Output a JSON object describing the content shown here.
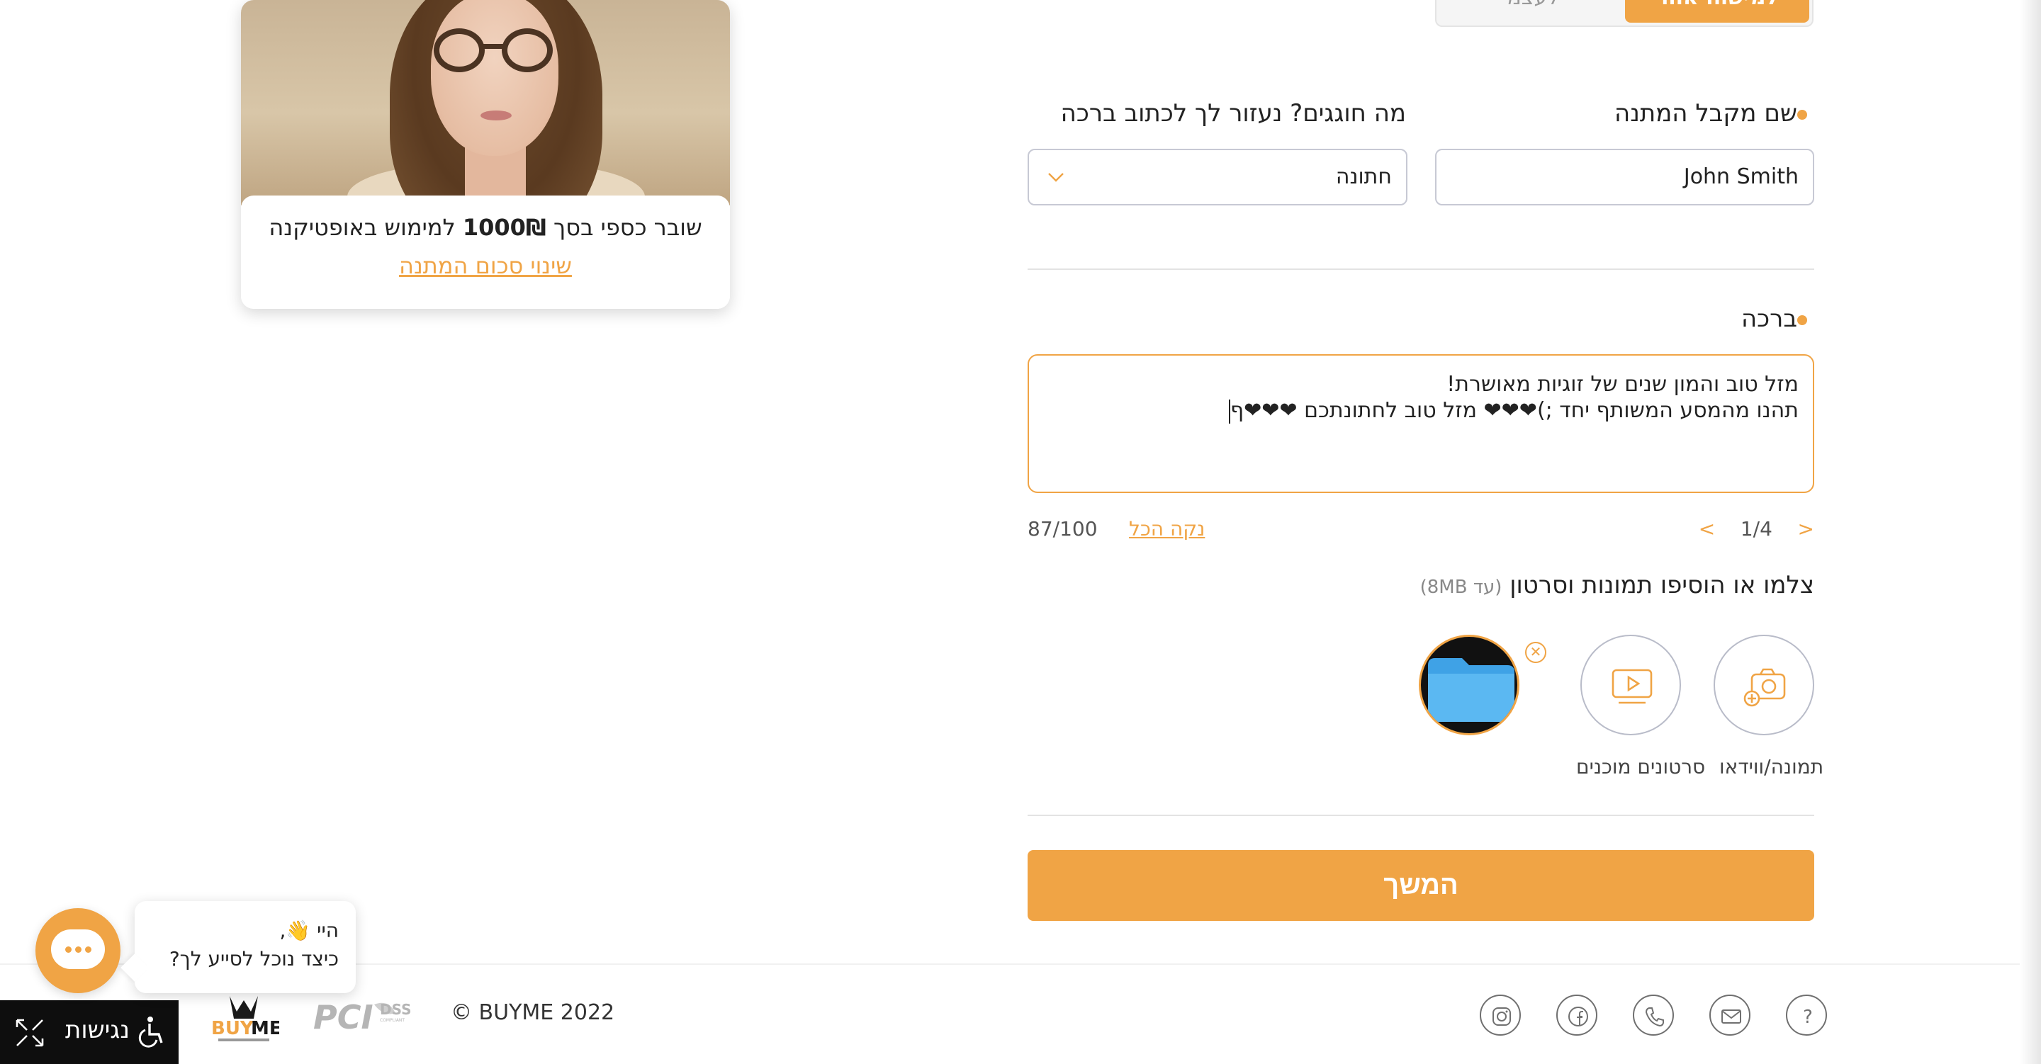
{
  "tabs": {
    "gift_for_other": "למישהו אחר",
    "gift_for_self": "לעצמי"
  },
  "product": {
    "voucher_prefix": "שובר כספי בסך ",
    "voucher_amount": "1000₪",
    "voucher_suffix": " למימוש באופטיקנה",
    "change_amount_link": "שינוי סכום המתנה"
  },
  "form": {
    "recipient_label": "שם מקבל המתנה",
    "recipient_value": "John Smith",
    "occasion_label": "מה חוגגים? נעזור לך לכתוב ברכה",
    "occasion_value": "חתונה",
    "greeting_label": "ברכה",
    "greeting_line1": "מזל טוב והמון שנים של זוגיות מאושרת!",
    "greeting_line2": "תהנו מהמסע המשותף יחד ;)❤❤❤ מזל טוב לחתונתכם ❤❤❤ף",
    "pager_prev": "<",
    "pager_text": "1/4",
    "pager_next": ">",
    "clear_all": "נקה הכל",
    "char_count": "87/100",
    "media_title": "צלמו או הוסיפו תמונות וסרטון",
    "media_hint": "(עד 8MB)",
    "media_photo_label": "תמונה/ווידאו",
    "media_ready_videos_label": "סרטונים מוכנים",
    "remove_label": "✕",
    "continue_button": "המשך"
  },
  "footer": {
    "copyright": "© BUYME 2022",
    "accessibility": "נגישות",
    "icons": [
      "help-icon",
      "email-icon",
      "phone-icon",
      "facebook-icon",
      "instagram-icon"
    ]
  },
  "chat": {
    "greeting_line1": "היי 👋,",
    "greeting_line2": "כיצד נוכל לסייע לך?"
  },
  "colors": {
    "accent": "#f0a445",
    "border": "#c7c9d4",
    "text": "#222222"
  }
}
